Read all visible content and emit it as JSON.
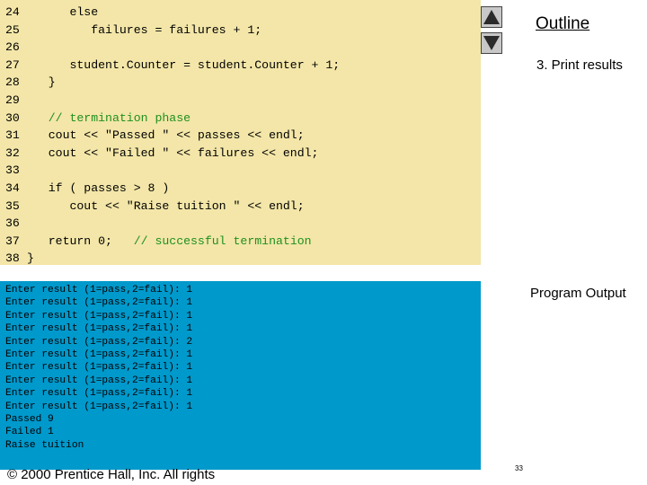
{
  "code": {
    "lines": [
      {
        "num": "24",
        "text": "      else"
      },
      {
        "num": "25",
        "text": "         failures = failures + 1;"
      },
      {
        "num": "26",
        "text": ""
      },
      {
        "num": "27",
        "text": "      student.Counter = student.Counter + 1;"
      },
      {
        "num": "28",
        "text": "   }"
      },
      {
        "num": "29",
        "text": ""
      },
      {
        "num": "30",
        "text": "   // termination phase"
      },
      {
        "num": "31",
        "text": "   cout << \"Passed \" << passes << endl;"
      },
      {
        "num": "32",
        "text": "   cout << \"Failed \" << failures << endl;"
      },
      {
        "num": "33",
        "text": ""
      },
      {
        "num": "34",
        "text": "   if ( passes > 8 )"
      },
      {
        "num": "35",
        "text": "      cout << \"Raise tuition \" << endl;"
      },
      {
        "num": "36",
        "text": ""
      },
      {
        "num": "37",
        "text": "   return 0;"
      },
      {
        "num": "38",
        "text": "}"
      }
    ],
    "inline_comment": "   // successful termination"
  },
  "output": {
    "lines": [
      "Enter result (1=pass,2=fail): 1",
      "Enter result (1=pass,2=fail): 1",
      "Enter result (1=pass,2=fail): 1",
      "Enter result (1=pass,2=fail): 1",
      "Enter result (1=pass,2=fail): 2",
      "Enter result (1=pass,2=fail): 1",
      "Enter result (1=pass,2=fail): 1",
      "Enter result (1=pass,2=fail): 1",
      "Enter result (1=pass,2=fail): 1",
      "Enter result (1=pass,2=fail): 1",
      "Passed 9",
      "Failed 1",
      "Raise tuition"
    ]
  },
  "nav": {
    "up_icon": "triangle-up-icon",
    "down_icon": "triangle-down-icon"
  },
  "sidebar": {
    "outline_label": "Outline",
    "section_label": "3. Print results",
    "output_label": "Program Output"
  },
  "footer": {
    "copyright": "© 2000 Prentice Hall, Inc.  All rights",
    "page_number": "33"
  },
  "colors": {
    "code_background": "#f3e6a8",
    "output_background": "#0099cc",
    "comment": "#1f8f1f"
  }
}
